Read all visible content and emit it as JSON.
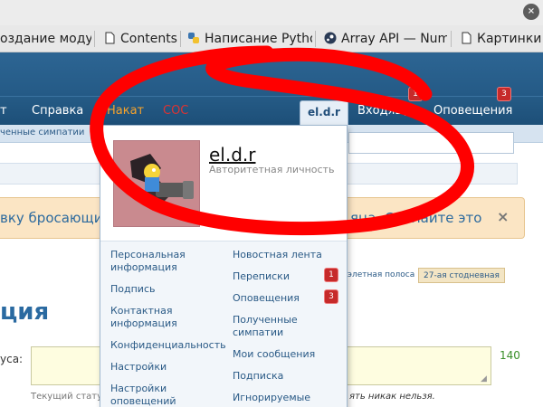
{
  "browser": {
    "bookmarks": [
      {
        "label": "оздание модул",
        "icon": "page-icon"
      },
      {
        "label": "Contents",
        "icon": "page-icon"
      },
      {
        "label": "Написание Pytho",
        "icon": "python-icon"
      },
      {
        "label": "Array API — Num",
        "icon": "steam-icon"
      },
      {
        "label": "Картинки",
        "icon": "page-icon"
      }
    ],
    "close_glyph": "×"
  },
  "nav": {
    "items": [
      {
        "label": "т"
      },
      {
        "label": "Справка"
      },
      {
        "label": "Накат"
      },
      {
        "label": "СОС"
      },
      {
        "label": "el.d.r"
      },
      {
        "label": "Входящ"
      },
      {
        "label": "Оповещения"
      }
    ],
    "badges": {
      "inbox": "1",
      "alerts": "3"
    }
  },
  "subbar": {
    "text": "ченные симпатии"
  },
  "notice": {
    "text_left": "вку бросающих",
    "text_right": "яца. Сделайте это",
    "close": "×"
  },
  "progress": {
    "tab_prev": "элетная полоса",
    "tab_active": "27-ая стодневная"
  },
  "page": {
    "heading": "ция",
    "status_label": "уса:",
    "char_count": "140",
    "hint_left": "Текущий стату",
    "hint_right": "ять никак нельзя."
  },
  "dropdown": {
    "username": "el.d.r",
    "user_title": "Авторитетная личность",
    "left_links": [
      "Персональная информация",
      "Подпись",
      "Контактная информация",
      "Конфиденциальность",
      "Настройки",
      "Настройки оповещений"
    ],
    "right_links": [
      "Новостная лента",
      "Переписки",
      "Оповещения",
      "Полученные симпатии",
      "Мои сообщения",
      "Подписка",
      "Игнорируемые"
    ],
    "right_badges": {
      "conversations": "1",
      "alerts": "3"
    }
  },
  "colors": {
    "header_blue": "#245a86",
    "accent_orange": "#f7a32b",
    "badge_red": "#c62a2a",
    "scribble_red": "#ff0000"
  }
}
